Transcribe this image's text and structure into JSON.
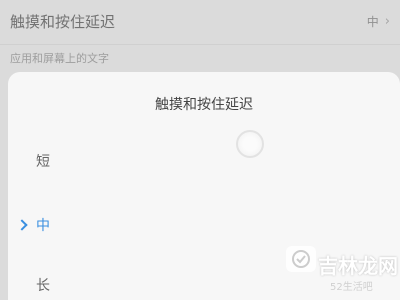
{
  "background": {
    "setting_title": "触摸和按住延迟",
    "setting_value": "中",
    "section_header": "应用和屏幕上的文字"
  },
  "dialog": {
    "title": "触摸和按住延迟",
    "options": [
      {
        "label": "短",
        "selected": false
      },
      {
        "label": "中",
        "selected": true
      },
      {
        "label": "长",
        "selected": false
      }
    ]
  },
  "watermark": {
    "name": "吉林龙网",
    "sub": "52生活吧"
  },
  "colors": {
    "accent": "#3a8fe0",
    "sheet": "#f7f7f7"
  }
}
